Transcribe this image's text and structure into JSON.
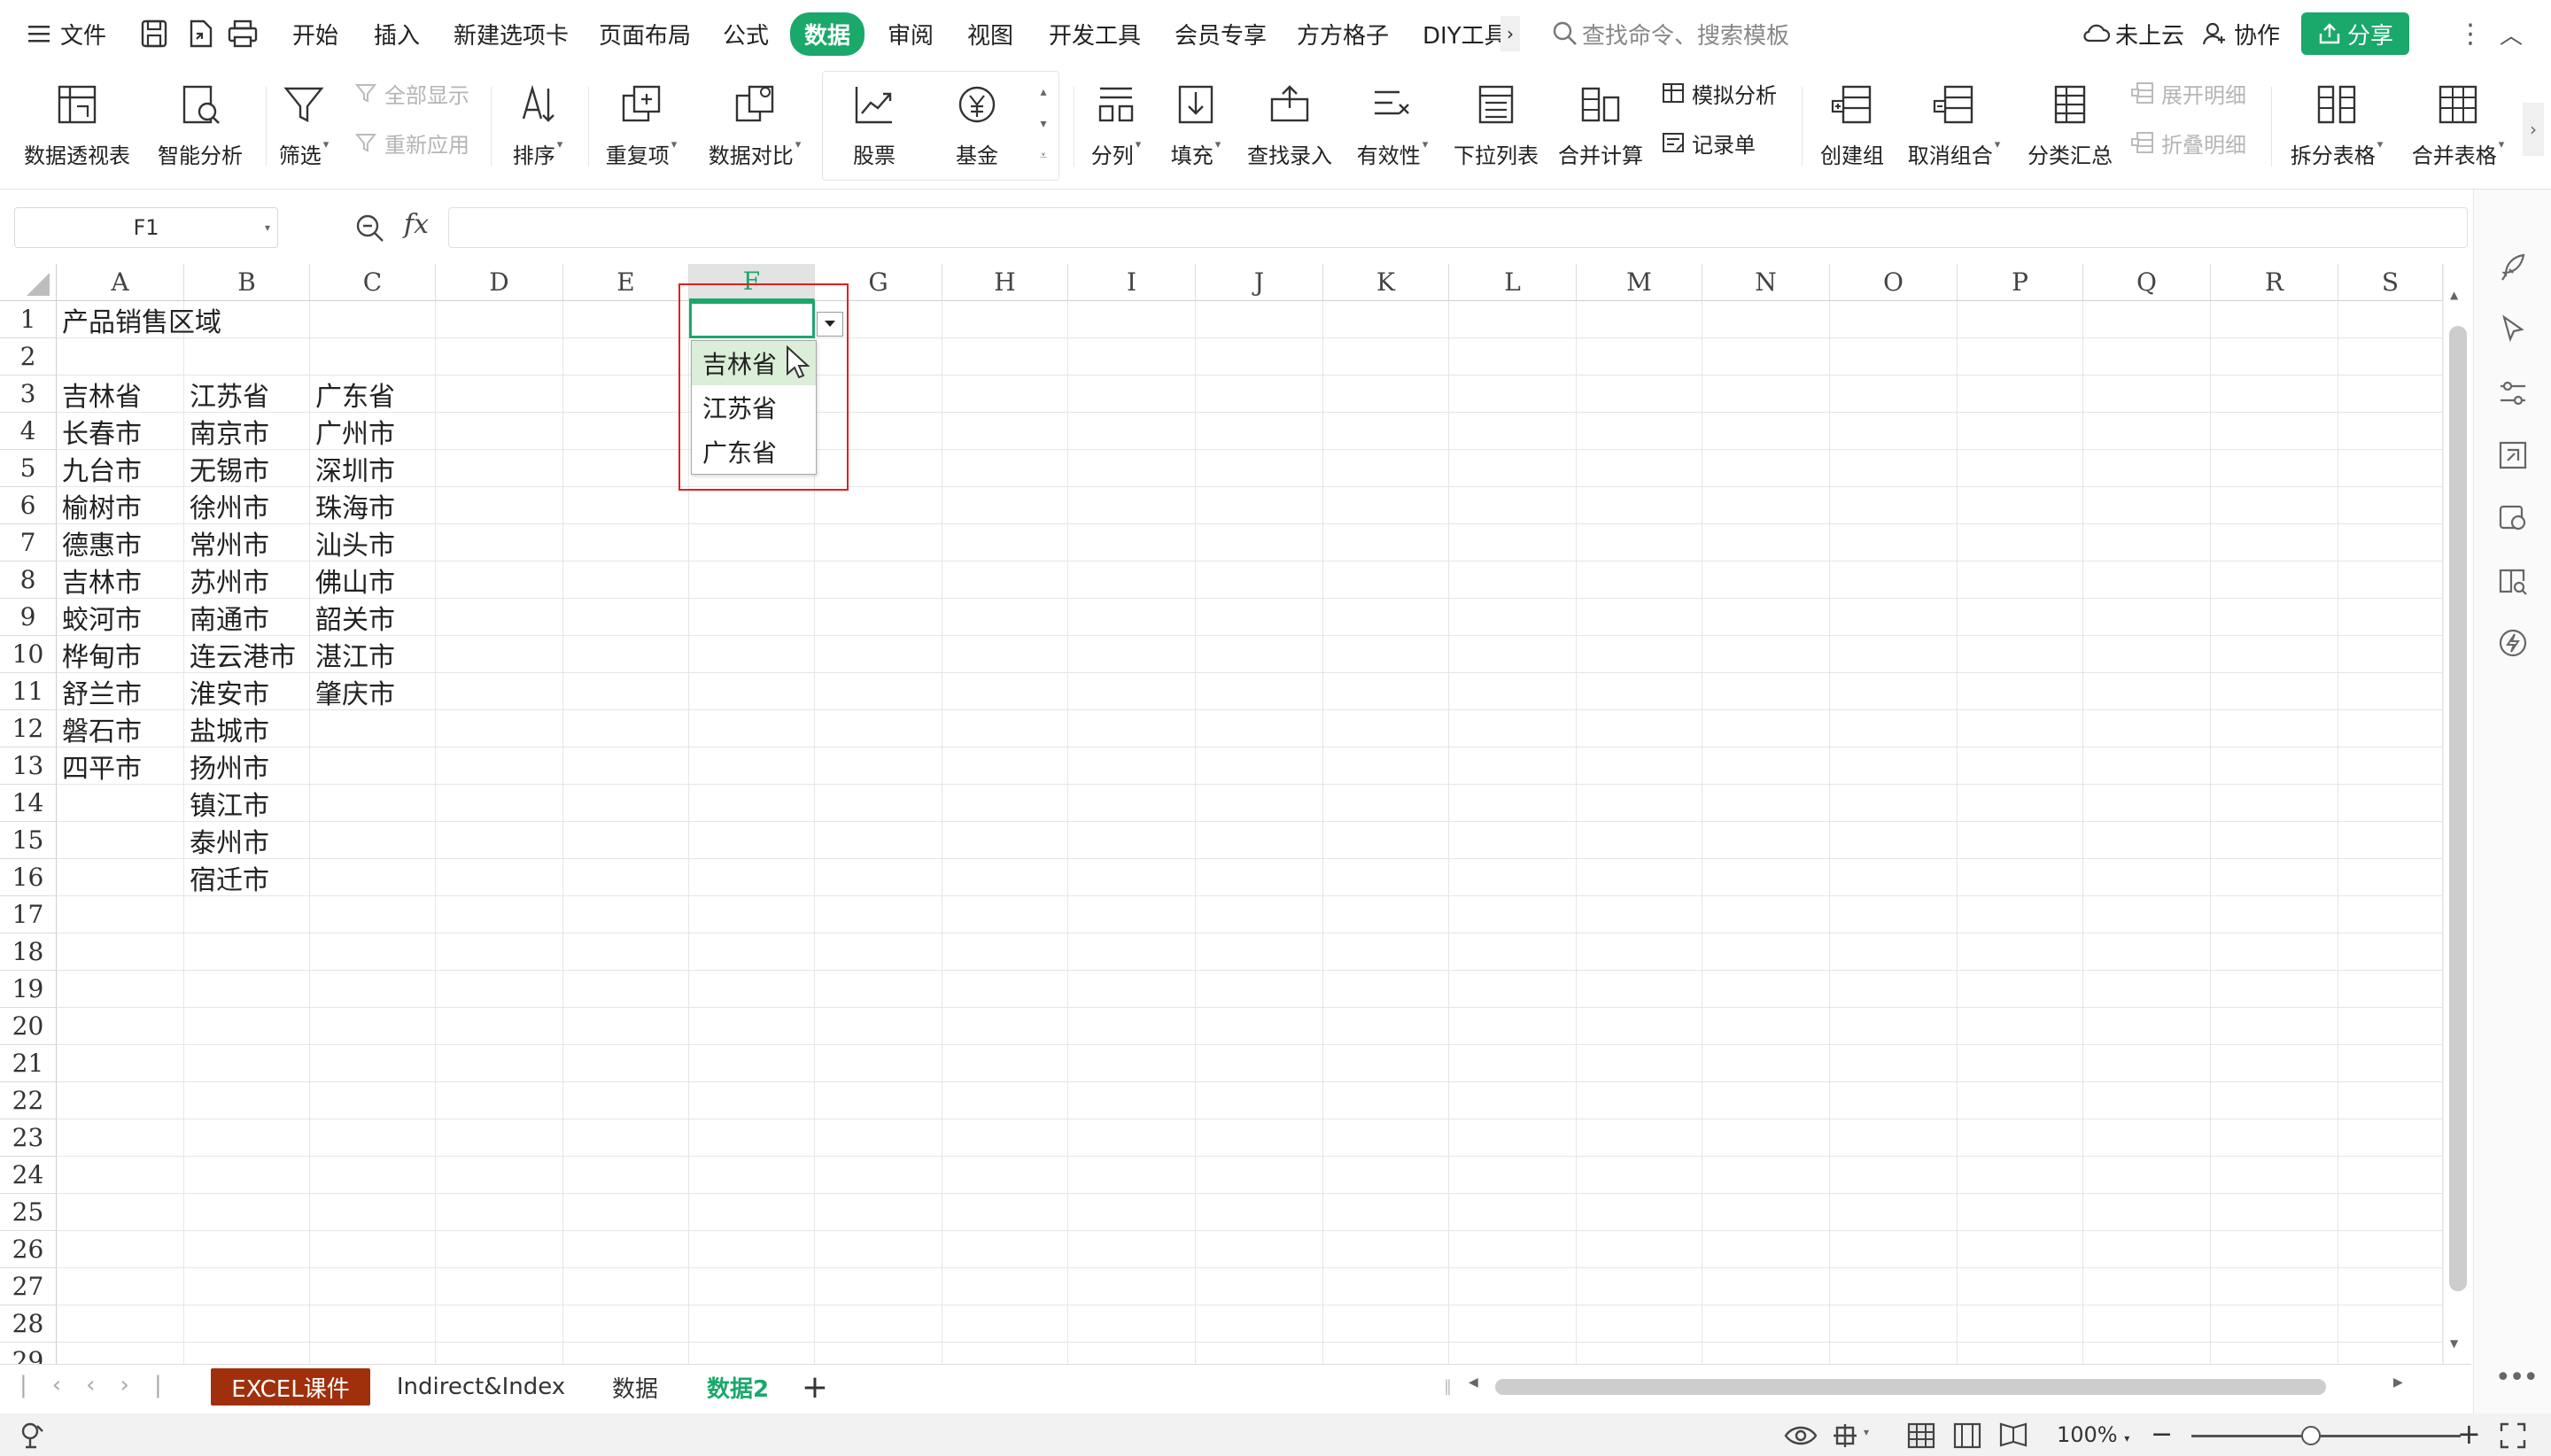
{
  "topbar": {
    "file_label": "文件",
    "menus": [
      "开始",
      "插入",
      "新建选项卡",
      "页面布局",
      "公式",
      "数据",
      "审阅",
      "视图",
      "开发工具",
      "会员专享",
      "方方格子",
      "DIY工具"
    ],
    "active_menu": "数据",
    "search_placeholder": "查找命令、搜索模板",
    "cloud_label": "未上云",
    "collab_label": "协作",
    "share_label": "分享",
    "accent": "#1aa86b"
  },
  "ribbon": {
    "pivot": "数据透视表",
    "smart": "智能分析",
    "filter": "筛选",
    "show_all": "全部显示",
    "reapply": "重新应用",
    "sort": "排序",
    "duplicates": "重复项",
    "compare": "数据对比",
    "stock": "股票",
    "fund": "基金",
    "split_col": "分列",
    "fill": "填充",
    "lookup": "查找录入",
    "validity": "有效性",
    "dropdown_list": "下拉列表",
    "consolidate": "合并计算",
    "whatif": "模拟分析",
    "record": "记录单",
    "group": "创建组",
    "ungroup": "取消组合",
    "subtotal": "分类汇总",
    "expand": "展开明细",
    "collapse": "折叠明细",
    "split_table": "拆分表格",
    "merge_table": "合并表格"
  },
  "formula_bar": {
    "name_box": "F1",
    "fx": "fx",
    "value": ""
  },
  "grid": {
    "columns": [
      "A",
      "B",
      "C",
      "D",
      "E",
      "F",
      "G",
      "H",
      "I",
      "J",
      "K",
      "L",
      "M",
      "N",
      "O",
      "P",
      "Q",
      "R",
      "S"
    ],
    "rows": [
      "1",
      "2",
      "3",
      "4",
      "5",
      "6",
      "7",
      "8",
      "9",
      "10",
      "11",
      "12",
      "13",
      "14",
      "15",
      "16",
      "17",
      "18",
      "19",
      "20",
      "21",
      "22",
      "23",
      "24",
      "25",
      "26",
      "27",
      "28",
      "29"
    ],
    "title": "产品销售区域",
    "col_a": [
      "吉林省",
      "长春市",
      "九台市",
      "榆树市",
      "德惠市",
      "吉林市",
      "蛟河市",
      "桦甸市",
      "舒兰市",
      "磐石市",
      "四平市"
    ],
    "col_b": [
      "江苏省",
      "南京市",
      "无锡市",
      "徐州市",
      "常州市",
      "苏州市",
      "南通市",
      "连云港市",
      "淮安市",
      "盐城市",
      "扬州市",
      "镇江市",
      "泰州市",
      "宿迁市"
    ],
    "col_c": [
      "广东省",
      "广州市",
      "深圳市",
      "珠海市",
      "汕头市",
      "佛山市",
      "韶关市",
      "湛江市",
      "肇庆市"
    ]
  },
  "dropdown": {
    "options": [
      "吉林省",
      "江苏省",
      "广东省"
    ],
    "highlighted": "吉林省"
  },
  "sheets": {
    "tabs": [
      "EXCEL课件",
      "Indirect&Index",
      "数据",
      "数据2"
    ],
    "active": "数据2"
  },
  "status": {
    "zoom": "100%"
  }
}
